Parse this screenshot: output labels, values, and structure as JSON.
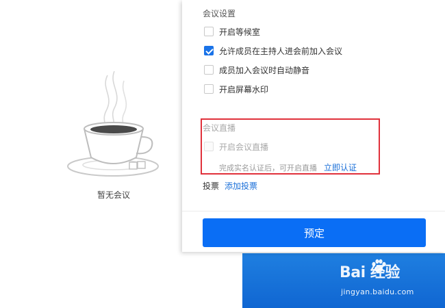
{
  "empty_state": {
    "icon": "coffee-cup-icon",
    "text": "暂无会议"
  },
  "settings": {
    "section_title": "会议设置",
    "options": [
      {
        "label": "开启等候室",
        "checked": false
      },
      {
        "label": "允许成员在主持人进会前加入会议",
        "checked": true
      },
      {
        "label": "成员加入会议时自动静音",
        "checked": false
      },
      {
        "label": "开启屏幕水印",
        "checked": false
      }
    ]
  },
  "live": {
    "section_title": "会议直播",
    "option_label": "开启会议直播",
    "enabled": false,
    "hint": "完成实名认证后，可开启直播",
    "verify_link": "立即认证"
  },
  "vote": {
    "label": "投票",
    "add_link": "添加投票"
  },
  "confirm_button": "预定",
  "watermark": {
    "logo_text": "Bai  经验",
    "url": "jingyan.baidu.com"
  },
  "colors": {
    "accent": "#0a6ef5",
    "highlight_border": "#e0303a",
    "link": "#1a6fd8"
  }
}
